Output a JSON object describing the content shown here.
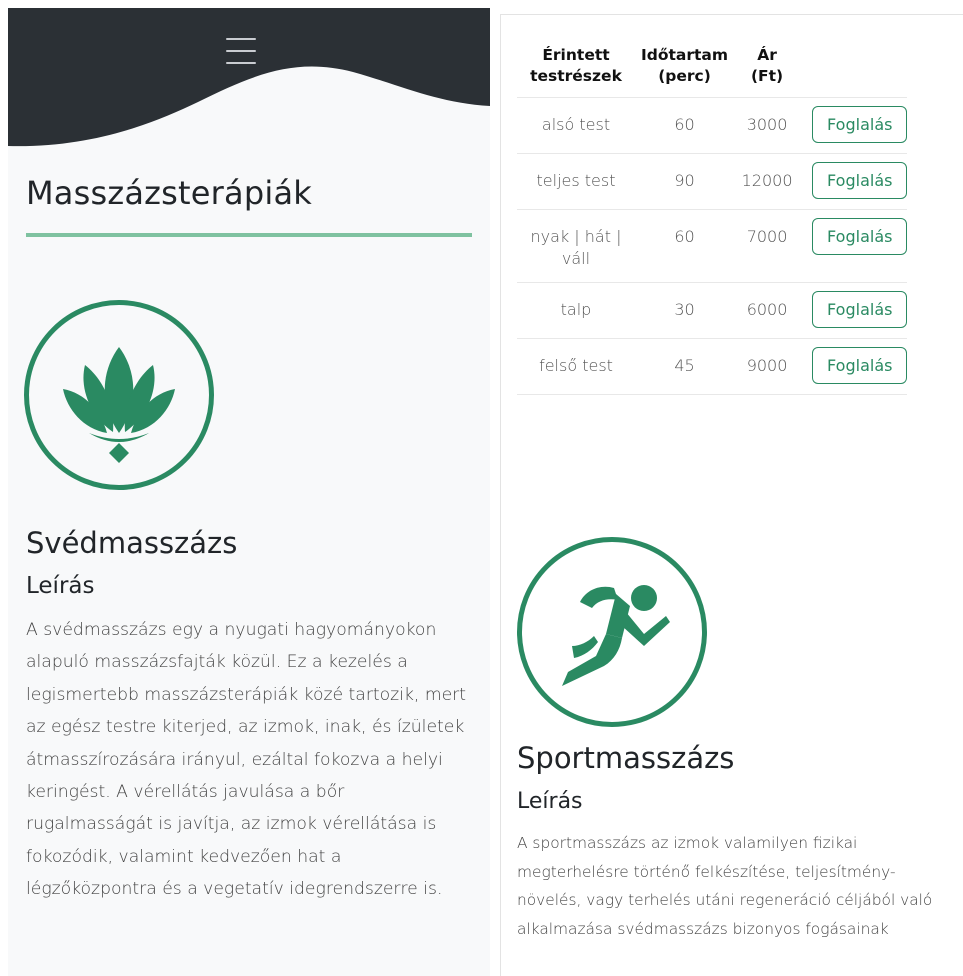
{
  "left": {
    "title": "Masszázsterápiák",
    "massage": {
      "icon": "lotus-icon",
      "name": "Svédmasszázs",
      "desc_heading": "Leírás",
      "description": "A svédmasszázs egy a nyugati hagyományokon alapuló masszázsfajták közül. Ez a kezelés a legismertebb masszázsterápiák közé tartozik, mert az egész testre kiterjed, az izmok, inak, és ízületek átmasszírozására irányul, ezáltal fokozva a helyi keringést. A vérellátás javulása a bőr rugalmasságát is javítja, az izmok vérellátása is fokozódik, valamint kedvezően hat a légzőközpontra és a vegetatív idegrendszerre is."
    }
  },
  "right": {
    "table": {
      "headers": [
        "Érintett testrészek",
        "Időtartam (perc)",
        "Ár (Ft)"
      ],
      "rows": [
        {
          "area": "alsó test",
          "duration": "60",
          "price": "3000",
          "button": "Foglalás"
        },
        {
          "area": "teljes test",
          "duration": "90",
          "price": "12000",
          "button": "Foglalás"
        },
        {
          "area": "nyak | hát | váll",
          "duration": "60",
          "price": "7000",
          "button": "Foglalás"
        },
        {
          "area": "talp",
          "duration": "30",
          "price": "6000",
          "button": "Foglalás"
        },
        {
          "area": "felső test",
          "duration": "45",
          "price": "9000",
          "button": "Foglalás"
        }
      ]
    },
    "massage": {
      "icon": "runner-icon",
      "name": "Sportmasszázs",
      "desc_heading": "Leírás",
      "description": "A sportmasszázs az izmok valamilyen fizikai megterhelésre történő felkészítése, teljesítmény-növelés, vagy terhelés utáni regeneráció céljából való alkalmazása svédmasszázs bizonyos fogásainak"
    }
  },
  "colors": {
    "accent": "#2a8a62",
    "header_bg": "#2b3035",
    "rule": "#7fc2a0"
  }
}
